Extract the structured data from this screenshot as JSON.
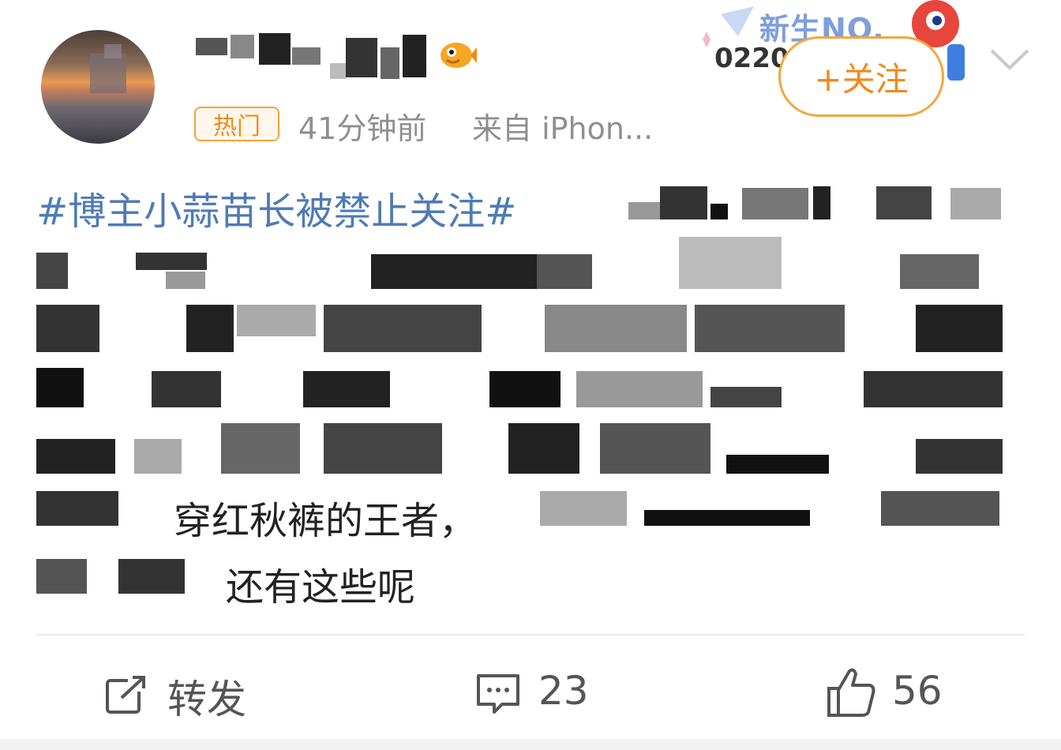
{
  "post": {
    "meta": {
      "hot_badge": "热门",
      "time": "41分钟前",
      "source": "来自 iPhon..."
    },
    "follow_label": "+关注",
    "medal": {
      "title": "新生NO.",
      "number": "0220"
    },
    "body": {
      "topic": "#博主小蒜苗长被禁止关注#",
      "line6_visible": "穿红秋裤的王者，",
      "line7_visible": "还有这些呢"
    }
  },
  "actions": {
    "repost_label": "转发",
    "comment_count": "23",
    "like_count": "56"
  },
  "icons": {
    "repost": "repost-icon",
    "comment": "comment-icon",
    "like": "thumbs-up-icon",
    "fish": "fish-badge-icon",
    "chevron": "chevron-down-icon"
  },
  "colors": {
    "topic": "#4f7bb5",
    "accent": "#f08a1a",
    "muted": "#8f8f8f"
  }
}
